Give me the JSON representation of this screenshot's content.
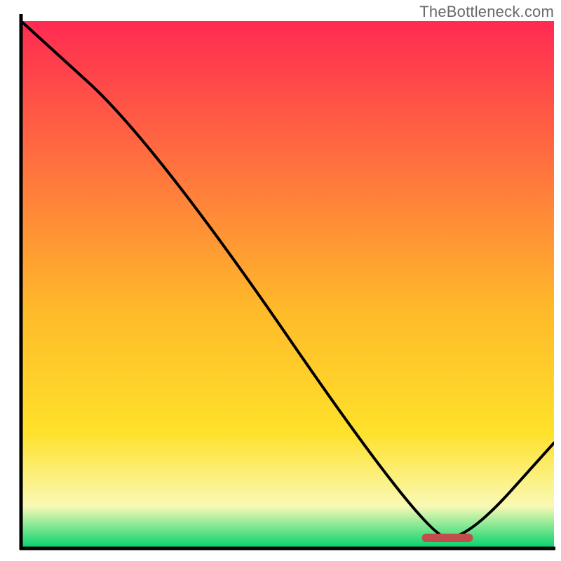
{
  "attribution": "TheBottleneck.com",
  "colors": {
    "axis": "#000000",
    "curve": "#000000",
    "floor_red": "#c34c4c",
    "gradient_top": "#ff2a52",
    "gradient_yellow": "#ffe12a",
    "gradient_pale": "#f9f9b5",
    "gradient_bottom": "#00d36c"
  },
  "chart_data": {
    "type": "line",
    "title": "",
    "xlabel": "",
    "ylabel": "",
    "xlim": [
      0,
      100
    ],
    "ylim": [
      0,
      100
    ],
    "x": [
      0,
      25,
      76,
      84,
      100
    ],
    "values": [
      100,
      77,
      2,
      2,
      20
    ],
    "floor_segment": {
      "x0": 76,
      "x1": 84,
      "y": 2
    }
  }
}
